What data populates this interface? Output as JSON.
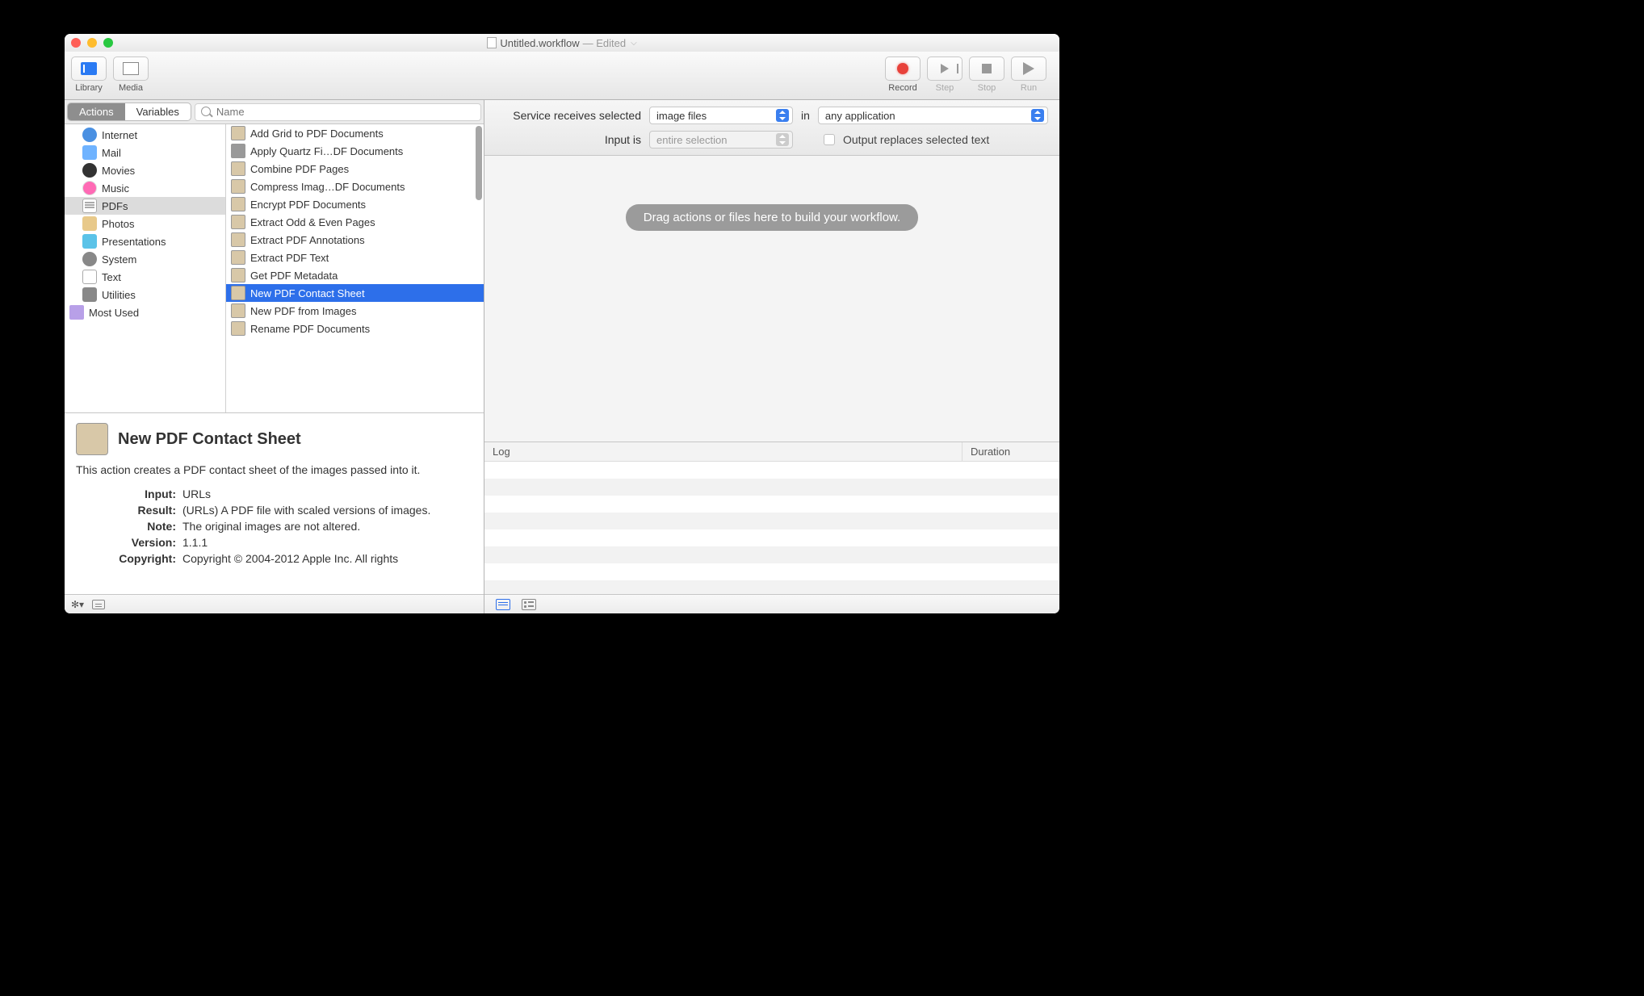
{
  "title": {
    "filename": "Untitled.workflow",
    "status": "— Edited"
  },
  "toolbar": {
    "library": "Library",
    "media": "Media",
    "record": "Record",
    "step": "Step",
    "stop": "Stop",
    "run": "Run"
  },
  "tabs": {
    "actions": "Actions",
    "variables": "Variables"
  },
  "search": {
    "placeholder": "Name"
  },
  "categories": [
    {
      "label": "Internet",
      "icon": "globe"
    },
    {
      "label": "Mail",
      "icon": "mail"
    },
    {
      "label": "Movies",
      "icon": "movies"
    },
    {
      "label": "Music",
      "icon": "music"
    },
    {
      "label": "PDFs",
      "icon": "pdf",
      "selected": true
    },
    {
      "label": "Photos",
      "icon": "photos"
    },
    {
      "label": "Presentations",
      "icon": "pres"
    },
    {
      "label": "System",
      "icon": "sys"
    },
    {
      "label": "Text",
      "icon": "text"
    },
    {
      "label": "Utilities",
      "icon": "util"
    },
    {
      "label": "Most Used",
      "icon": "folder",
      "indent": false
    }
  ],
  "actions": [
    {
      "label": "Add Grid to PDF Documents"
    },
    {
      "label": "Apply Quartz Fi…DF Documents",
      "icon": "util"
    },
    {
      "label": "Combine PDF Pages"
    },
    {
      "label": "Compress Imag…DF Documents"
    },
    {
      "label": "Encrypt PDF Documents"
    },
    {
      "label": "Extract Odd & Even Pages"
    },
    {
      "label": "Extract PDF Annotations"
    },
    {
      "label": "Extract PDF Text"
    },
    {
      "label": "Get PDF Metadata"
    },
    {
      "label": "New PDF Contact Sheet",
      "selected": true
    },
    {
      "label": "New PDF from Images"
    },
    {
      "label": "Rename PDF Documents"
    }
  ],
  "detail": {
    "title": "New PDF Contact Sheet",
    "desc": "This action creates a PDF contact sheet of the images passed into it.",
    "rows": {
      "input_l": "Input:",
      "input_v": "URLs",
      "result_l": "Result:",
      "result_v": "(URLs) A PDF file with scaled versions of images.",
      "note_l": "Note:",
      "note_v": "The original images are not altered.",
      "version_l": "Version:",
      "version_v": "1.1.1",
      "copyright_l": "Copyright:",
      "copyright_v": "Copyright © 2004-2012 Apple Inc.  All rights"
    }
  },
  "service": {
    "receives_l": "Service receives selected",
    "type": "image files",
    "in": "in",
    "app": "any application",
    "input_is_l": "Input is",
    "input_is_v": "entire selection",
    "output_replaces": "Output replaces selected text"
  },
  "workflow": {
    "hint": "Drag actions or files here to build your workflow."
  },
  "log": {
    "col1": "Log",
    "col2": "Duration"
  }
}
